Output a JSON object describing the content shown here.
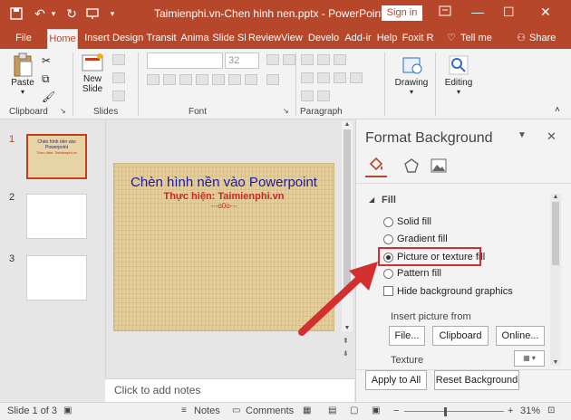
{
  "window": {
    "title": "Taimienphi.vn-Chen hinh nen.pptx - PowerPoint",
    "sign_in": "Sign in"
  },
  "tabs": [
    "File",
    "Home",
    "Insert",
    "Design",
    "Transit",
    "Anima",
    "Slide Sl",
    "Review",
    "View",
    "Develo",
    "Add-ir",
    "Help",
    "Foxit R"
  ],
  "tell_me": "Tell me",
  "share": "Share",
  "ribbon": {
    "clipboard": {
      "label": "Clipboard",
      "paste": "Paste"
    },
    "slides": {
      "label": "Slides",
      "new_slide_line1": "New",
      "new_slide_line2": "Slide"
    },
    "font": {
      "label": "Font",
      "size": "32"
    },
    "paragraph": {
      "label": "Paragraph"
    },
    "drawing": {
      "label": "Drawing"
    },
    "editing": {
      "label": "Editing"
    }
  },
  "thumbnails": [
    {
      "number": "1",
      "selected": true,
      "title": "Chèn hình nền vào Powerpoint",
      "sub": "Thực hiện: Taimienphi.vn"
    },
    {
      "number": "2",
      "selected": false
    },
    {
      "number": "3",
      "selected": false
    }
  ],
  "slide": {
    "title": "Chèn hình nền vào Powerpoint",
    "subtitle": "Thực hiện: Taimienphi.vn",
    "deco": "---o0o---"
  },
  "notes_placeholder": "Click to add notes",
  "format_pane": {
    "title": "Format Background",
    "fill_header": "Fill",
    "options": [
      {
        "label": "Solid fill",
        "checked": false
      },
      {
        "label": "Gradient fill",
        "checked": false
      },
      {
        "label": "Picture or texture fill",
        "checked": true
      },
      {
        "label": "Pattern fill",
        "checked": false
      }
    ],
    "hide_bg_label": "Hide background graphics",
    "insert_picture_from": "Insert picture from",
    "file_btn": "File...",
    "clipboard_btn": "Clipboard",
    "online_btn": "Online...",
    "texture_label": "Texture",
    "apply_all": "Apply to All",
    "reset_bg": "Reset Background"
  },
  "status": {
    "slide_info": "Slide 1 of 3",
    "notes": "Notes",
    "comments": "Comments",
    "zoom": "31%"
  },
  "colors": {
    "accent": "#b7472a",
    "highlight": "#d32f2f",
    "slide_title": "#1a1aa6",
    "slide_sub": "#c62828"
  }
}
